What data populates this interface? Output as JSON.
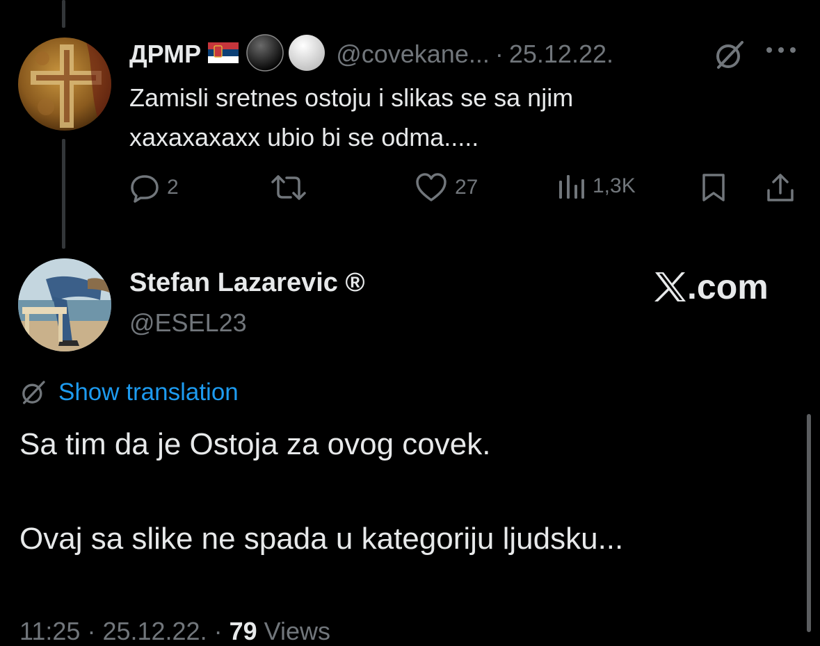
{
  "reply": {
    "display_name": "ДРМР",
    "flag_icon": "serbia-flag-icon",
    "handle": "@covekane...",
    "separator": "·",
    "date": "25.12.22.",
    "text_lines": [
      "Zamisli sretnes ostoju i slikas se sa njim",
      "xaxaxaxaxx ubio bi se odma....."
    ],
    "stats": {
      "replies": "2",
      "likes": "27",
      "views": "1,3K"
    }
  },
  "main": {
    "display_name": "Stefan Lazarevic ®",
    "handle": "@ESEL23",
    "watermark": ".com",
    "watermark_icon": "x-logo-icon",
    "show_translation": "Show translation",
    "paragraphs": [
      "Sa tim da je Ostoja za ovog covek.",
      "Ovaj sa slike ne spada u kategoriju ljudsku..."
    ],
    "footer": {
      "time": "11:25",
      "date": "25.12.22.",
      "views": "79",
      "views_label": "Views"
    }
  },
  "colors": {
    "background": "#000000",
    "text": "#e7e9ea",
    "muted": "#71767b",
    "link": "#1d9bf0"
  }
}
